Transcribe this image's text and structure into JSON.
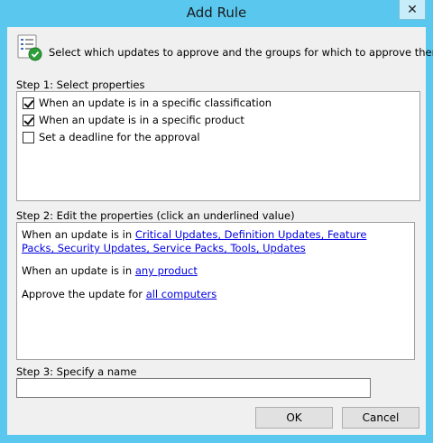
{
  "window": {
    "title": "Add Rule",
    "close_glyph": "✕"
  },
  "header": {
    "icon": "checklist-approve-icon",
    "text": "Select which updates to approve and the groups for which to approve them."
  },
  "step1": {
    "label": "Step 1: Select properties",
    "items": [
      {
        "label": "When an update is in a specific classification",
        "checked": true
      },
      {
        "label": "When an update is in a specific product",
        "checked": true
      },
      {
        "label": "Set a deadline for the approval",
        "checked": false
      }
    ]
  },
  "step2": {
    "label": "Step 2: Edit the properties (click an underlined value)",
    "line1_prefix": "When an update is in ",
    "classifications_link": "Critical Updates, Definition Updates, Feature Packs, Security Updates, Service Packs, Tools, Updates",
    "line2_prefix": "When an update is in ",
    "product_link": "any product",
    "line3_prefix": "Approve the update for ",
    "computers_link": "all computers"
  },
  "step3": {
    "label": "Step 3: Specify a name",
    "name_value": "",
    "name_placeholder": ""
  },
  "buttons": {
    "ok": "OK",
    "cancel": "Cancel"
  }
}
